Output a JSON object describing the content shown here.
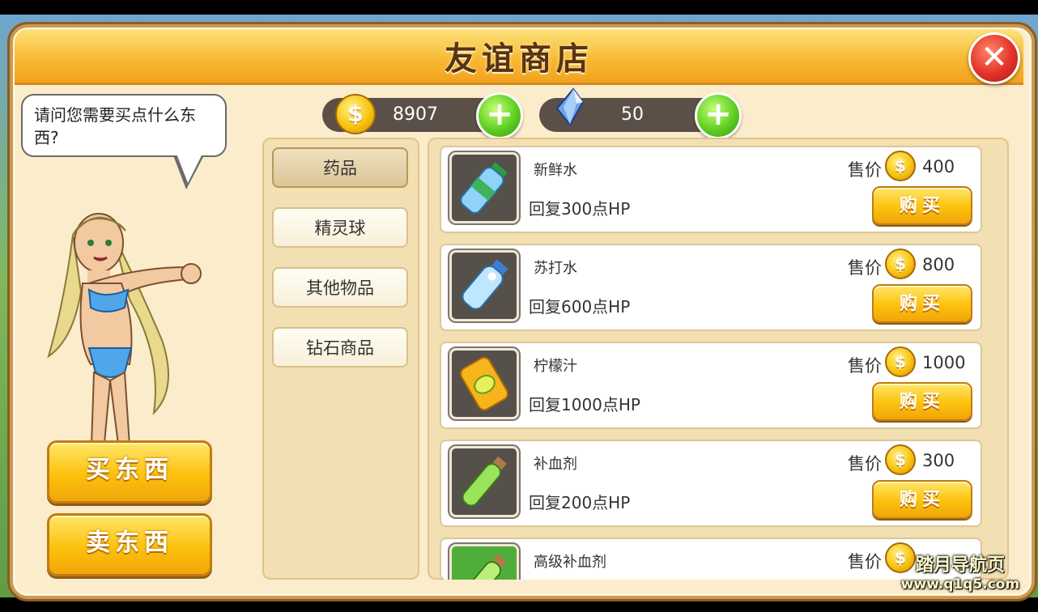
{
  "title": "友谊商店",
  "close_icon": "close-icon",
  "dialog": "请问您需要买点什么东西?",
  "currency": {
    "gold": "8907",
    "diamond": "50"
  },
  "actions": {
    "buy": "买东西",
    "sell": "卖东西"
  },
  "categories": [
    "药品",
    "精灵球",
    "其他物品",
    "钻石商品"
  ],
  "active_category": "药品",
  "price_label": "售价",
  "buy_label": "购买",
  "items": [
    {
      "name": "新鲜水",
      "desc": "回复300点HP",
      "price": "400",
      "icon": "water-bottle-icon"
    },
    {
      "name": "苏打水",
      "desc": "回复600点HP",
      "price": "800",
      "icon": "soda-bottle-icon"
    },
    {
      "name": "柠檬汁",
      "desc": "回复1000点HP",
      "price": "1000",
      "icon": "lemon-can-icon"
    },
    {
      "name": "补血剂",
      "desc": "回复200点HP",
      "price": "300",
      "icon": "potion-vial-icon"
    },
    {
      "name": "高级补血剂",
      "desc": "",
      "price": "",
      "icon": "super-potion-vial-icon"
    }
  ],
  "watermark": {
    "line1": "踏月导航页",
    "line2": "www.q1q5.com"
  },
  "colors": {
    "title_bar": "#f7b72f",
    "panel": "#fbeccb",
    "buy_button": "#fcc20d",
    "plus_button": "#5fcf22",
    "close_button": "#e3322a"
  }
}
